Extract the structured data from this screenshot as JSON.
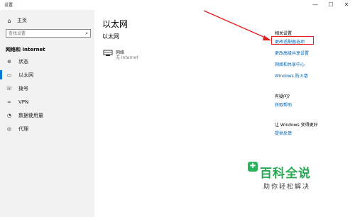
{
  "window": {
    "title": "设置",
    "min": "—",
    "max": "☐",
    "close": "✕"
  },
  "sidebar": {
    "home_label": "主页",
    "search_placeholder": "查找设置",
    "section_title": "网络和 Internet",
    "items": [
      {
        "label": "状态",
        "icon": "status-icon"
      },
      {
        "label": "以太网",
        "icon": "ethernet-icon",
        "active": true
      },
      {
        "label": "拨号",
        "icon": "dialup-icon"
      },
      {
        "label": "VPN",
        "icon": "vpn-icon"
      },
      {
        "label": "数据使用量",
        "icon": "data-usage-icon"
      },
      {
        "label": "代理",
        "icon": "globe-icon"
      }
    ]
  },
  "main": {
    "page_title": "以太网",
    "sub_title": "以太网",
    "network": {
      "name": "网络",
      "status": "无 Internet"
    }
  },
  "right": {
    "related_header": "相关设置",
    "related_links": [
      "更改适配器选项",
      "更改高级共享设置",
      "网络和共享中心",
      "Windows 防火墙"
    ],
    "question_header": "有疑问?",
    "help_link": "获取帮助",
    "improve_header": "让 Windows 变得更好",
    "feedback_link": "提供反馈"
  },
  "watermark": {
    "title": "百科全说",
    "subtitle": "助你轻松解决"
  },
  "colors": {
    "accent": "#0078d7",
    "link": "#0063b1",
    "annotation": "#e02020",
    "watermark": "#2aa854"
  }
}
